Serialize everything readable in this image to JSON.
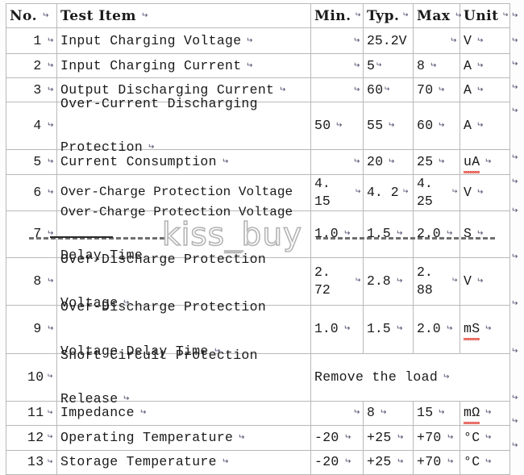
{
  "document": {
    "type": "specification-table",
    "background_color": "#fdfdfd",
    "border_color": "#b9b9b9",
    "text_color": "#1a1a1a"
  },
  "watermark": {
    "text": "kiss_buy",
    "color": "#b4b4b4",
    "style": "outlined"
  },
  "table": {
    "columns": [
      {
        "key": "no",
        "label": "No."
      },
      {
        "key": "item",
        "label": "Test Item"
      },
      {
        "key": "min",
        "label": "Min."
      },
      {
        "key": "typ",
        "label": "Typ."
      },
      {
        "key": "max",
        "label": "Max"
      },
      {
        "key": "unit",
        "label": "Unit"
      }
    ],
    "rows": [
      {
        "no": "1",
        "item": "Input Charging Voltage",
        "min": "",
        "typ": "25.2V",
        "max": "",
        "unit": "V"
      },
      {
        "no": "2",
        "item": "Input Charging Current",
        "min": "",
        "typ": "5",
        "max": "8",
        "unit": "A"
      },
      {
        "no": "3",
        "item": "Output Discharging Current",
        "min": "",
        "typ": "60",
        "max": "70",
        "unit": "A"
      },
      {
        "no": "4",
        "item": "Over-Current Discharging Protection",
        "item_line1": "Over-Current Discharging",
        "item_line2": "Protection",
        "min": "50",
        "typ": "55",
        "max": "60",
        "unit": "A"
      },
      {
        "no": "5",
        "item": "Current Consumption",
        "min": "",
        "typ": "20",
        "max": "25",
        "unit": "uA"
      },
      {
        "no": "6",
        "item": "Over-Charge Protection Voltage",
        "min": "4. 15",
        "typ": "4. 2",
        "max": "4. 25",
        "unit": "V"
      },
      {
        "no": "7",
        "item": "Over-Charge Protection Voltage Delay Time",
        "item_line1": "Over-Charge Protection Voltage",
        "item_line2": "Delay Time",
        "min": "1.0",
        "typ": "1.5",
        "max": "2.0",
        "unit": "S"
      },
      {
        "no": "8",
        "item": "Over-Discharge Protection Voltage",
        "item_line1": "Over-Discharge Protection",
        "item_line2": "Voltage",
        "min": "2. 72",
        "typ": "2.8",
        "max": "2. 88",
        "unit": "V"
      },
      {
        "no": "9",
        "item": "Over-Discharge Protection Voltage Delay Time",
        "item_line1": "Over-Discharge Protection",
        "item_line2": "Voltage Delay Time",
        "min": "1.0",
        "typ": "1.5",
        "max": "2.0",
        "unit": "mS"
      },
      {
        "no": "10",
        "item": "Short Circuit Protection Release",
        "item_line1": "Short Circuit Protection",
        "item_line2": "Release",
        "merged_value": "Remove the load"
      },
      {
        "no": "11",
        "item": "Impedance",
        "min": "",
        "typ": "8",
        "max": "15",
        "unit": "mΩ"
      },
      {
        "no": "12",
        "item": "Operating Temperature",
        "min": "-20",
        "typ": "+25",
        "max": "+70",
        "unit": "°C"
      },
      {
        "no": "13",
        "item": "Storage Temperature",
        "min": "-20",
        "typ": "+25",
        "max": "+70",
        "unit": "°C"
      }
    ]
  },
  "marks": {
    "paragraph_mark": "↵"
  }
}
